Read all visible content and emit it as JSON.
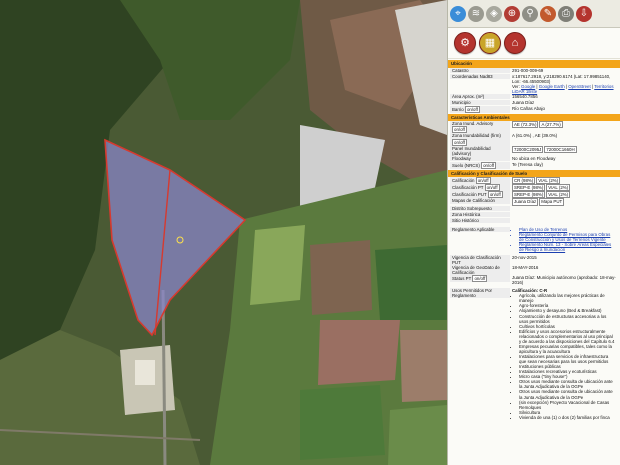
{
  "toolbar": {
    "icons": [
      "map-pin-icon",
      "layers-icon",
      "basemap-icon",
      "zoom-icon",
      "search-icon",
      "measure-icon",
      "print-icon",
      "export-icon"
    ]
  },
  "tools": {
    "icons": [
      "tools-icon",
      "legend-icon",
      "home-icon"
    ]
  },
  "colors": {
    "section_header": "#f3a51a",
    "parcel_fill": "#8a86c8",
    "parcel_stroke": "#d63a2f",
    "link": "#1b3fb0"
  },
  "sections": {
    "ubicacion": "Ubicación",
    "caracteristicas": "Características Ambientales",
    "calificacion": "Calificación y Clasificación de Suelo"
  },
  "ubicacion": {
    "catastro_label": "Catastro",
    "catastro": "291-000-009-69",
    "coordenadas_label": "Coordenadas Nad83",
    "coordenadas": "x:187617.2918, y:218290.6174 (Lat: 17.99851140, Lon: -66.45500903)",
    "ver_prefix": "Ver: ",
    "ver_links": [
      "Google",
      "Google Earth",
      "OpenStreet",
      "Territorios",
      "LiDAR 1lliste"
    ],
    "area_label": "Área Aprox. (m²)",
    "area": "156540.7856",
    "municipio_label": "Municipio",
    "municipio": "Juana Díaz",
    "barrio_label": "Barrio",
    "barrio": "Río Cañas Abajo"
  },
  "toggle": "on/off",
  "caracteristicas": {
    "zona_inund_label": "Zona Inund. Advisory",
    "zona_inund_vals": [
      "AE (72.3%)",
      "A (27.7%)"
    ],
    "zona_inund_firm_label": "Zona Inundabilidad (firm)",
    "zona_inund_firm": "A (61.0%) , AE (39.0%)",
    "panel_label": "Panel Inundabilidad (advisory)",
    "panel_vals": [
      "72000C2095J",
      "72000C1660H"
    ],
    "floodway_label": "Floodway",
    "floodway": "No ubica en Floodway",
    "suelo_label": "Suelo (NRCS)",
    "suelo": "Te (Teresa clay)"
  },
  "calificacion": {
    "calif_label": "Calificación",
    "calif_vals": [
      "CR (98%)",
      "VIAL (2%)"
    ],
    "calif_pt_label": "Clasificación PT",
    "calif_pt_vals": [
      "SREP-E (98%)",
      "VIAL (2%)"
    ],
    "calif_put_label": "Clasificación PUT",
    "calif_put_vals": [
      "SREP-E (98%)",
      "VIAL (2%)"
    ],
    "mapas_label": "Mapas de Calificación",
    "mapas_vals": [
      "Juana Díaz",
      "Mapa PUT"
    ],
    "distrito_label": "Distrito Sobrepuesto",
    "distrito": "",
    "zona_hist_label": "Zona Histórica",
    "zona_hist": "",
    "sitio_hist_label": "Sitio Histórico",
    "sitio_hist": "",
    "reglamento_label": "Reglamento Aplicable",
    "reglamento_links": [
      "Plan de Uso de Terrenos",
      "Reglamento Conjunto de Permisos para Obras de Construcción y Usos de Terrenos Vigente",
      "Reglamento Núm. 13 - Sobre Áreas Especiales de Riesgo a Inundación"
    ],
    "vigencia_label": "Vigencia de Clasificación PUT",
    "vigencia": "20-nov-2015",
    "vigencia_geo_label": "Vigencia de GeoDato de Calificación",
    "vigencia_geo": "18-MAY-2016",
    "status_label": "Status PT",
    "status": "Juana Díaz: Municipio autónomo (aprobado: 18-may-2016)",
    "usos_label": "Usos Permitidos Por Reglamento",
    "usos_title": "Calificación: C-R",
    "usos": [
      "Agrícola, utilizando las mejores prácticas de manejo",
      "Agro-forestería",
      "Alojamiento y desayuno (Bed & Breakfast)",
      "Construcción de estructuras accesorias a los usos permitidos",
      "Cultivos hortícolas",
      "Edificios y usos accesorios estructuralmente relacionados o complementarios al uso principal y de acuerdo a las disposiciones del Capítulo 6.4",
      "Empresas pecuarias compatibles, tales como la apicultura y la acuacultura",
      "Instalaciones para servicios de infraestructura que sean necesarias para los usos permitidos",
      "Instituciones públicas",
      "Instalaciones recreativas y ecoturísticas",
      "Micro casa (\"tiny house\")",
      "Otros usos mediante consulta de ubicación ante la Junta Adjudicativa de la OGPe",
      "Otros usos mediante consulta de ubicación ante la Junta Adjudicativa de la OGPe",
      "(sin excepción) Proyecto Vacacional de Casas Remolques",
      "Silvicultura",
      "Vivienda de una (1) o dos (2) familias por finca"
    ]
  }
}
